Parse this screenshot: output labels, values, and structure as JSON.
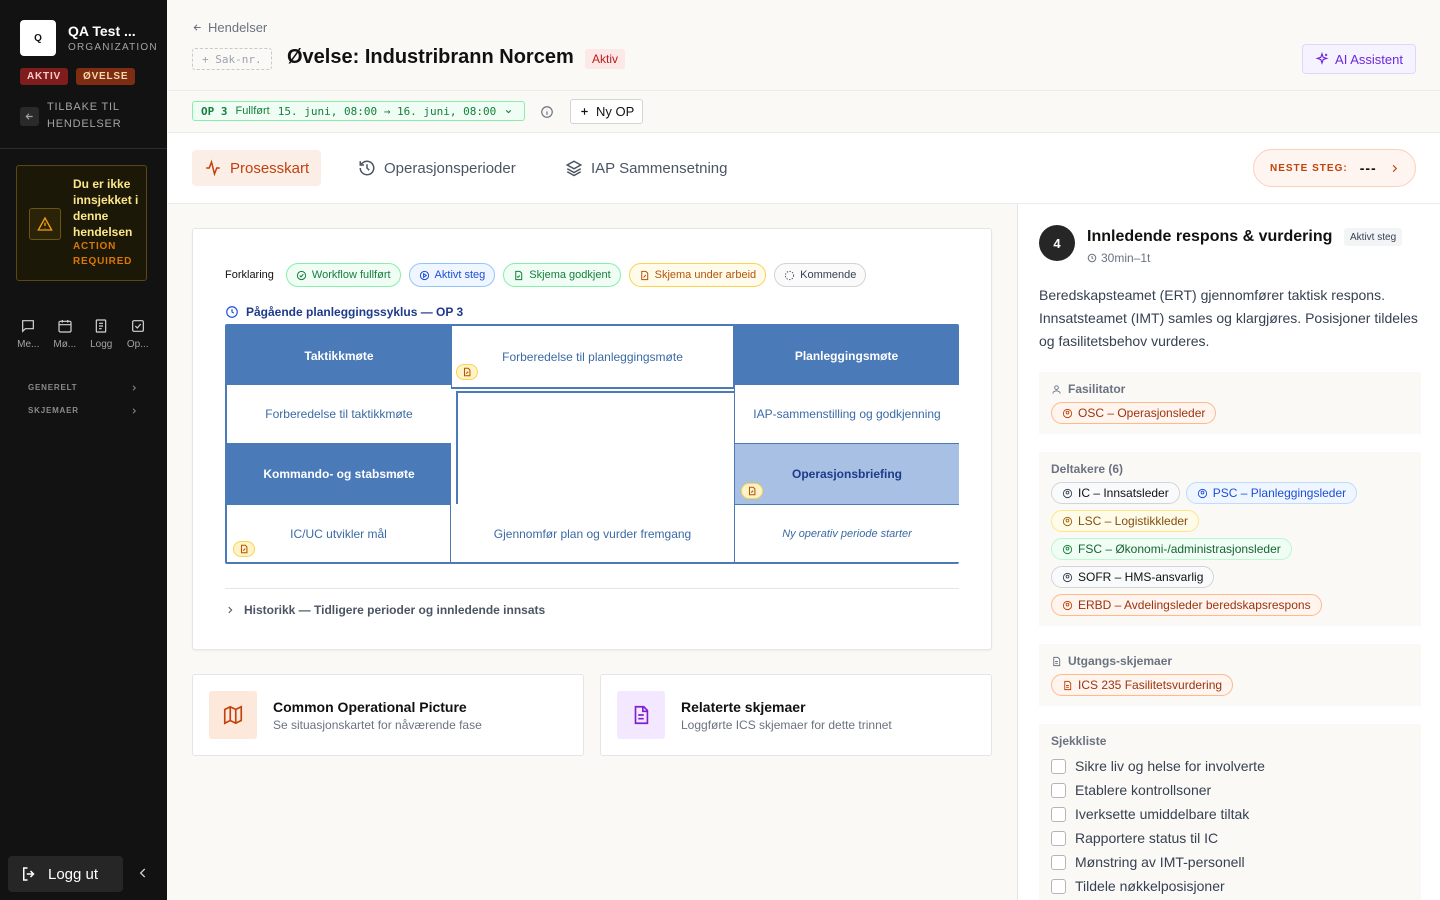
{
  "sidebar": {
    "org_logo": "Q",
    "org_name": "QA Test ...",
    "org_sub": "ORGANIZATION",
    "tag_aktiv": "AKTIV",
    "tag_ovelse": "ØVELSE",
    "back_label": "TILBAKE TIL HENDELSER",
    "warning_title": "Du er ikke innsjekket i denne hendelsen",
    "warning_sub": "ACTION REQUIRED",
    "nav": [
      {
        "label": "Me...",
        "icon": "chat-icon"
      },
      {
        "label": "Mø...",
        "icon": "calendar-icon"
      },
      {
        "label": "Logg",
        "icon": "log-icon"
      },
      {
        "label": "Op...",
        "icon": "checkbox-icon"
      }
    ],
    "section_generelt": "GENERELT",
    "section_skjemaer": "SKJEMAER",
    "logout_label": "Logg ut"
  },
  "header": {
    "breadcrumb": "Hendelser",
    "sak_placeholder": "+ Sak-nr.",
    "title": "Øvelse: Industribrann Norcem",
    "status": "Aktiv",
    "ai_button": "AI Assistent"
  },
  "opbar": {
    "op_number": "OP 3",
    "op_status": "Fullført",
    "op_range": "15. juni, 08:00 → 16. juni, 08:00",
    "new_op": "Ny OP"
  },
  "tabs": [
    {
      "label": "Prosesskart",
      "icon": "activity-icon",
      "active": true
    },
    {
      "label": "Operasjonsperioder",
      "icon": "history-icon",
      "active": false
    },
    {
      "label": "IAP Sammensetning",
      "icon": "layers-icon",
      "active": false
    }
  ],
  "next_step": {
    "label": "NESTE STEG:",
    "value": "---"
  },
  "legend": {
    "label": "Forklaring",
    "items": [
      {
        "label": "Workflow fullført",
        "color": "#15803d"
      },
      {
        "label": "Aktivt steg",
        "color": "#1d4ed8"
      },
      {
        "label": "Skjema godkjent",
        "color": "#15803d"
      },
      {
        "label": "Skjema under arbeid",
        "color": "#b45309"
      },
      {
        "label": "Kommende",
        "color": "#4b5563"
      }
    ]
  },
  "cycle": {
    "title": "Pågående planleggingssyklus — OP 3",
    "cells": {
      "taktikkmote": "Taktikkmøte",
      "forb_planlegging": "Forberedelse til planleggingsmøte",
      "planleggingsmote": "Planleggingsmøte",
      "forb_taktikk": "Forberedelse til taktikkmøte",
      "iap": "IAP-sammenstilling og godkjenning",
      "kommando": "Kommando- og stabsmøte",
      "briefing": "Operasjonsbriefing",
      "icuc": "IC/UC utvikler mål",
      "gjennomfor": "Gjennomfør plan og vurder fremgang",
      "ny_periode": "Ny operativ periode starter"
    }
  },
  "history_label": "Historikk — Tidligere perioder og innledende innsats",
  "cards": [
    {
      "title": "Common Operational Picture",
      "sub": "Se situasjonskartet for nåværende fase",
      "icon": "map-icon"
    },
    {
      "title": "Relaterte skjemaer",
      "sub": "Loggførte ICS skjemaer for dette trinnet",
      "icon": "document-icon"
    }
  ],
  "step": {
    "number": "4",
    "title": "Innledende respons & vurdering",
    "badge": "Aktivt steg",
    "time": "30min–1t",
    "description": "Beredskapsteamet (ERT) gjennomfører taktisk respons. Innsatsteamet (IMT) samles og klargjøres. Posisjoner tildeles og fasilitetsbehov vurderes.",
    "facilitator_label": "Fasilitator",
    "facilitator": {
      "label": "OSC – Operasjonsleder",
      "color": "#c2410c"
    },
    "participants_label": "Deltakere (6)",
    "participants": [
      {
        "label": "IC – Innsatsleder",
        "color": "#374151"
      },
      {
        "label": "PSC – Planleggingsleder",
        "color": "#1d4ed8"
      },
      {
        "label": "LSC – Logistikkleder",
        "color": "#a16207"
      },
      {
        "label": "FSC – Økonomi-/administrasjonsleder",
        "color": "#15803d"
      },
      {
        "label": "SOFR – HMS-ansvarlig",
        "color": "#374151"
      },
      {
        "label": "ERBD – Avdelingsleder beredskapsrespons",
        "color": "#c2410c"
      }
    ],
    "outputs_label": "Utgangs-skjemaer",
    "outputs": [
      {
        "label": "ICS 235 Fasilitetsvurdering",
        "color": "#c2410c"
      }
    ],
    "checklist_label": "Sjekkliste",
    "checklist": [
      "Sikre liv og helse for involverte",
      "Etablere kontrollsoner",
      "Iverksette umiddelbare tiltak",
      "Rapportere status til IC",
      "Mønstring av IMT-personell",
      "Tildele nøkkelposisjoner"
    ]
  }
}
